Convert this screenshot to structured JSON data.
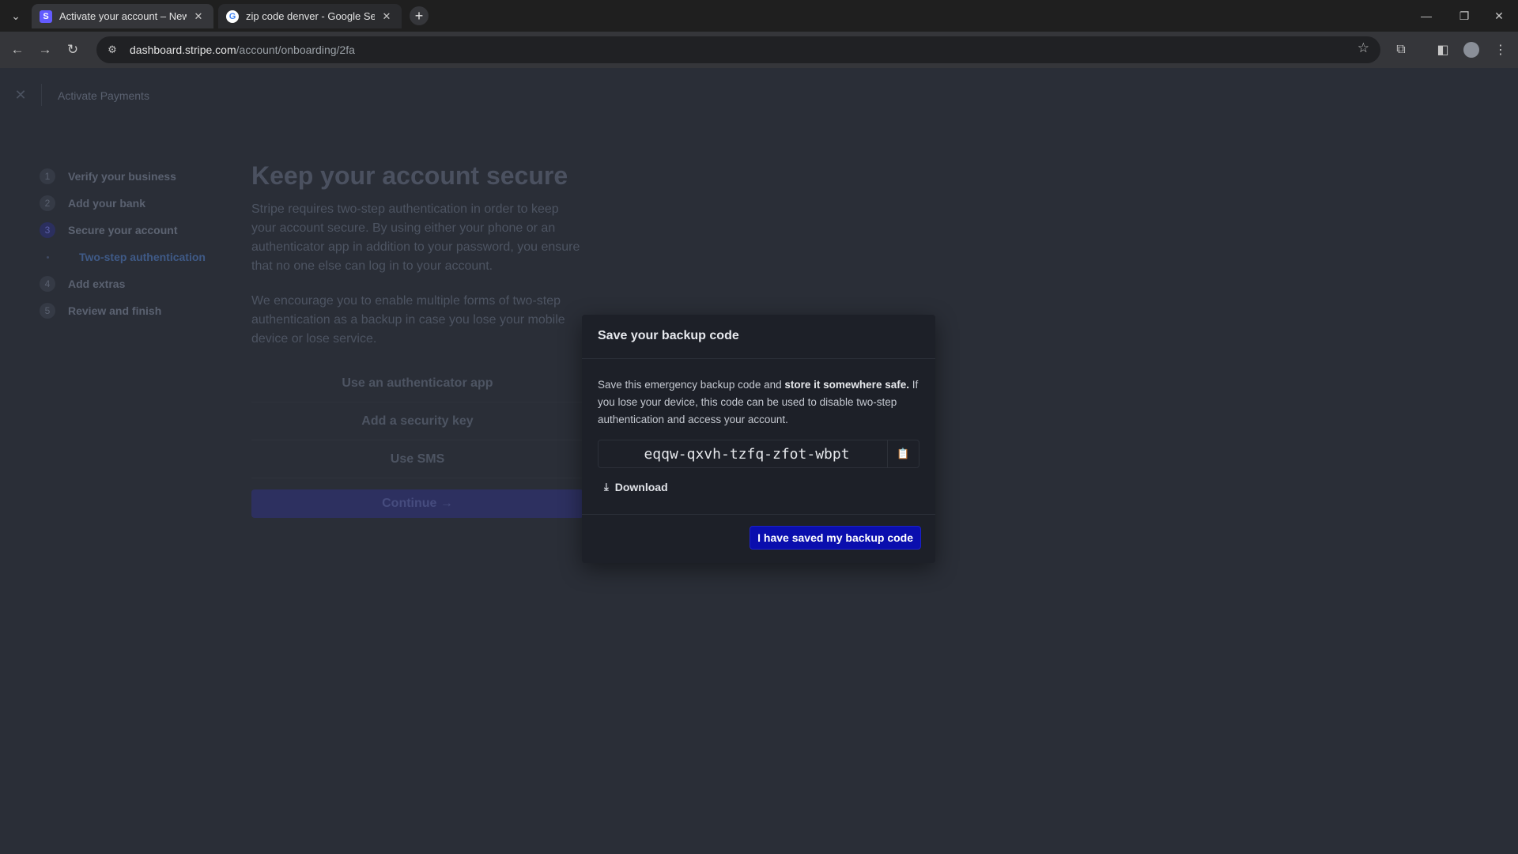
{
  "browser": {
    "tabs": [
      {
        "title": "Activate your account – New Bu",
        "favicon": "stripe-icon",
        "active": true
      },
      {
        "title": "zip code denver - Google Searc",
        "favicon": "google-icon",
        "active": false
      }
    ],
    "url": {
      "host": "dashboard.stripe.com",
      "path": "/account/onboarding/2fa"
    }
  },
  "page": {
    "header_title": "Activate Payments",
    "steps": [
      {
        "num": "1",
        "label": "Verify your business"
      },
      {
        "num": "2",
        "label": "Add your bank"
      },
      {
        "num": "3",
        "label": "Secure your account"
      },
      {
        "num": "4",
        "label": "Add extras"
      },
      {
        "num": "5",
        "label": "Review and finish"
      }
    ],
    "substep": "Two-step authentication",
    "heading": "Keep your account secure",
    "para1": "Stripe requires two-step authentication in order to keep your account secure. By using either your phone or an authenticator app in addition to your password, you ensure that no one else can log in to your account.",
    "para2": "We encourage you to enable multiple forms of two-step authentication as a backup in case you lose your mobile device or lose service.",
    "options": [
      "Use an authenticator app",
      "Add a security key",
      "Use SMS"
    ],
    "continue_label": "Continue →"
  },
  "modal": {
    "title": "Save your backup code",
    "desc_pre": "Save this emergency backup code and ",
    "desc_bold": "store it somewhere safe.",
    "desc_post": " If you lose your device, this code can be used to disable two-step authentication and access your account.",
    "code": "eqqw-qxvh-tzfq-zfot-wbpt",
    "download_label": "Download",
    "confirm_label": "I have saved my backup code"
  },
  "colors": {
    "accent": "#0a0eae",
    "stripe": "#635bff"
  }
}
